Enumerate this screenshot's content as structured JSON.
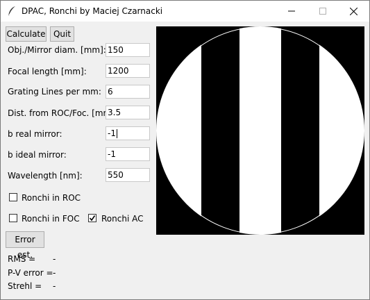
{
  "window": {
    "title": "DPAC, Ronchi by Maciej Czarnacki"
  },
  "buttons": {
    "calculate": "Calculate",
    "quit": "Quit",
    "error_est": "Error est."
  },
  "params": {
    "obj_diam": {
      "label": "Obj./Mirror diam. [mm]:",
      "value": "150"
    },
    "focal_length": {
      "label": "Focal length [mm]:",
      "value": "1200"
    },
    "grating": {
      "label": "Grating Lines per mm:",
      "value": "6"
    },
    "distance": {
      "label": "Dist. from ROC/Foc. [mm]:",
      "value": "3.5"
    },
    "b_real": {
      "label": "b real mirror:",
      "value": "-1"
    },
    "b_ideal": {
      "label": "b ideal mirror:",
      "value": "-1"
    },
    "wavelength": {
      "label": "Wavelength [nm]:",
      "value": "550"
    }
  },
  "checks": {
    "roc": {
      "label": "Ronchi in ROC",
      "checked": false
    },
    "foc": {
      "label": "Ronchi in FOC",
      "checked": false
    },
    "ac": {
      "label": "Ronchi AC",
      "checked": true
    }
  },
  "results": {
    "rms_label": "RMS =",
    "rms_value": "-",
    "pv_label": "P-V error =",
    "pv_value": "-",
    "strehl_label": "Strehl =",
    "strehl_value": "-"
  },
  "ronchigram": {
    "band_color": "#ffffff",
    "background_color": "#000000"
  }
}
